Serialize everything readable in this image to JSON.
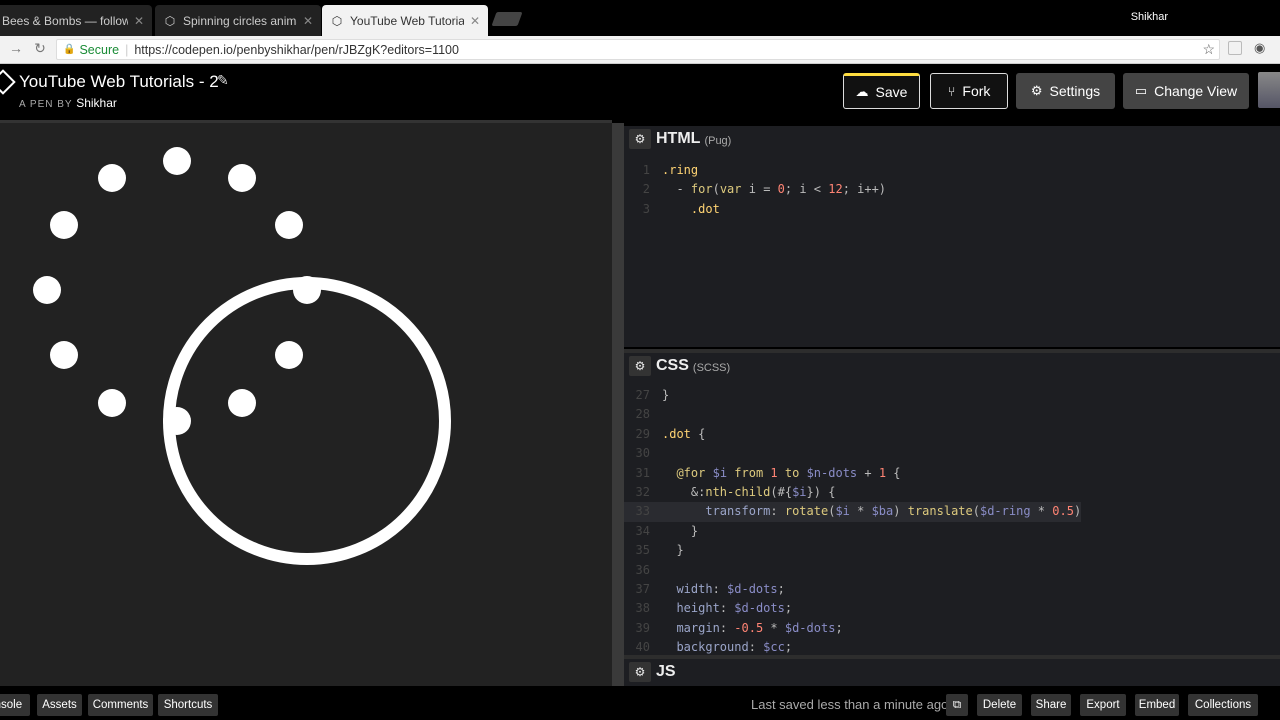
{
  "browser": {
    "tabs": [
      {
        "title": "Bees & Bombs — follow",
        "icon": "twitter-icon"
      },
      {
        "title": "Spinning circles animatio",
        "icon": "codepen-icon"
      },
      {
        "title": "YouTube Web Tutorials -",
        "icon": "codepen-icon"
      }
    ],
    "user": "Shikhar",
    "secure_label": "Secure",
    "url": "https://codepen.io/penbyshikhar/pen/rJBZgK?editors=1100"
  },
  "pen": {
    "title": "YouTube Web Tutorials - 2",
    "byline_prefix": "A PEN BY",
    "author": "Shikhar"
  },
  "header_buttons": {
    "save": "Save",
    "fork": "Fork",
    "settings": "Settings",
    "change_view": "Change View"
  },
  "editors": {
    "html": {
      "title": "HTML",
      "sub": "(Pug)"
    },
    "css": {
      "title": "CSS",
      "sub": "(SCSS)"
    },
    "js": {
      "title": "JS"
    }
  },
  "html_code": [
    {
      "n": "1",
      "t": ".ring"
    },
    {
      "n": "2",
      "t": "  - for(var i = 0; i < 12; i++)"
    },
    {
      "n": "3",
      "t": "    .dot"
    }
  ],
  "css_code": [
    {
      "n": "27",
      "t": "}"
    },
    {
      "n": "28",
      "t": ""
    },
    {
      "n": "29",
      "t": ".dot {"
    },
    {
      "n": "30",
      "t": ""
    },
    {
      "n": "31",
      "t": "  @for $i from 1 to $n-dots + 1 {"
    },
    {
      "n": "32",
      "t": "    &:nth-child(#{$i}) {"
    },
    {
      "n": "33",
      "t": "      transform: rotate($i * $ba) translate($d-ring * 0.5)"
    },
    {
      "n": "34",
      "t": "    }"
    },
    {
      "n": "35",
      "t": "  }"
    },
    {
      "n": "36",
      "t": ""
    },
    {
      "n": "37",
      "t": "  width: $d-dots;"
    },
    {
      "n": "38",
      "t": "  height: $d-dots;"
    },
    {
      "n": "39",
      "t": "  margin: -0.5 * $d-dots;"
    },
    {
      "n": "40",
      "t": "  background: $cc;"
    }
  ],
  "footer": {
    "console": "Console",
    "assets": "Assets",
    "comments": "Comments",
    "shortcuts": "Shortcuts",
    "last_saved": "Last saved less than a minute ago",
    "delete": "Delete",
    "share": "Share",
    "export": "Export",
    "embed": "Embed",
    "collections": "Collections"
  },
  "colors": {
    "save_accent": "#ffdd40",
    "preview_bg": "#222222",
    "editor_bg": "#1d1e22",
    "secure_green": "#1a8c36"
  }
}
